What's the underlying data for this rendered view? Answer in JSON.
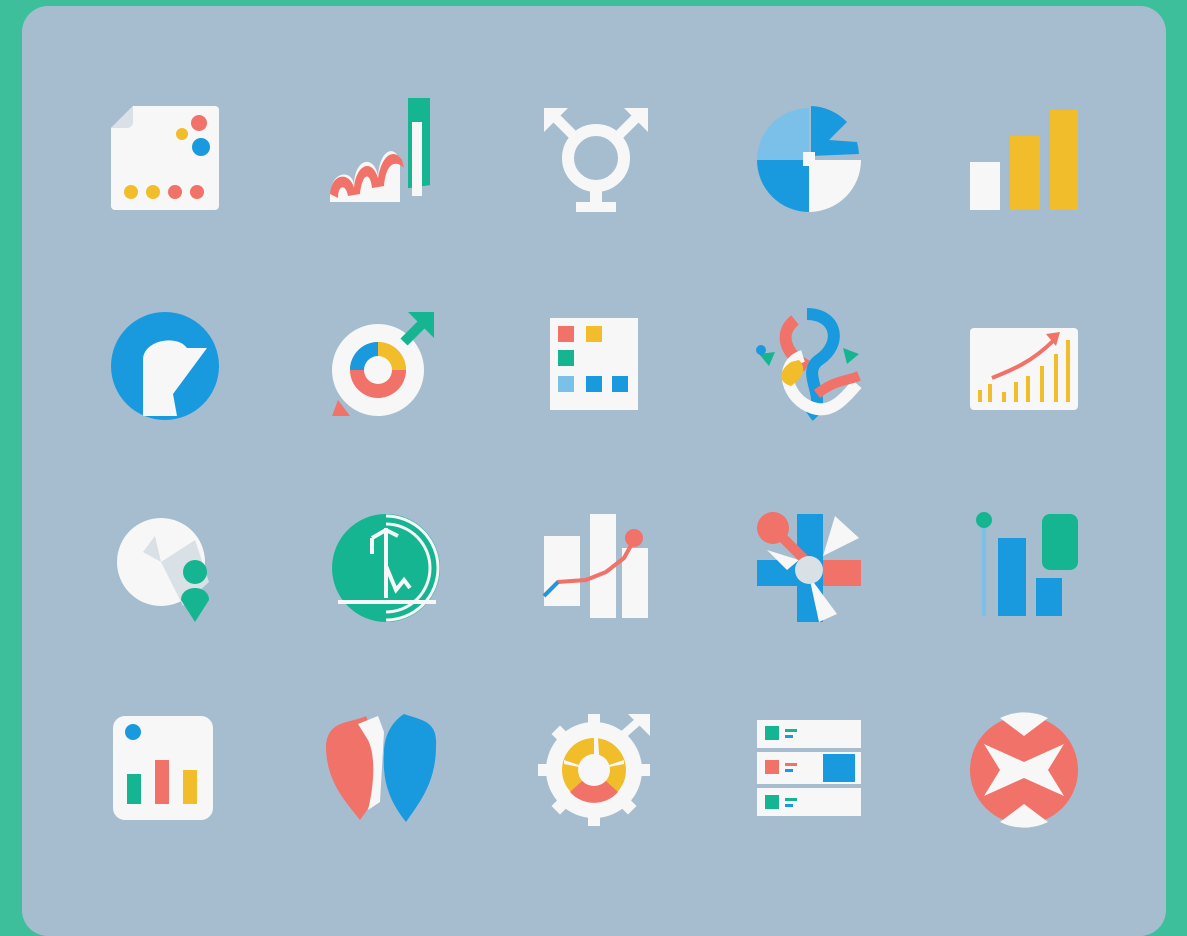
{
  "background_color": "#3dbf9c",
  "panel_color": "#a6bdcf",
  "palette": {
    "white": "#f7f7f7",
    "coral": "#f07268",
    "blue": "#1a9ade",
    "light_blue": "#7bc0e8",
    "yellow": "#f2bd2a",
    "teal": "#16b591"
  },
  "icons": [
    {
      "name": "document-dots-icon"
    },
    {
      "name": "wave-bars-icon"
    },
    {
      "name": "transgender-symbol-icon"
    },
    {
      "name": "pie-chart-icon"
    },
    {
      "name": "bar-chart-icon"
    },
    {
      "name": "blue-circle-flag-icon"
    },
    {
      "name": "donut-arrow-icon"
    },
    {
      "name": "color-grid-icon"
    },
    {
      "name": "intertwined-ribbons-icon"
    },
    {
      "name": "growth-chart-icon"
    },
    {
      "name": "pie-person-icon"
    },
    {
      "name": "teal-circle-graph-icon"
    },
    {
      "name": "bars-trend-line-icon"
    },
    {
      "name": "pinwheel-cross-icon"
    },
    {
      "name": "pin-bars-icon"
    },
    {
      "name": "dashboard-bars-icon"
    },
    {
      "name": "shields-icon"
    },
    {
      "name": "gear-donut-icon"
    },
    {
      "name": "list-rows-icon"
    },
    {
      "name": "coral-circle-arrows-icon"
    }
  ]
}
